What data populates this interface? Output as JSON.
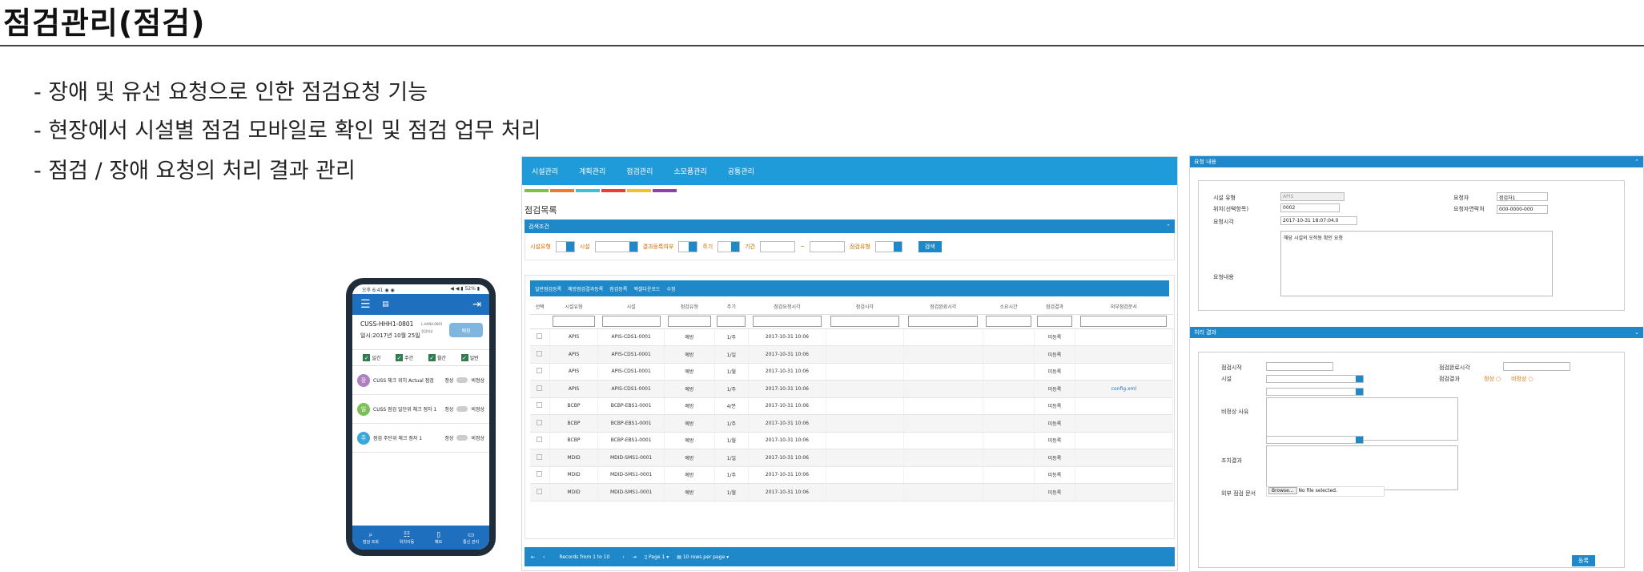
{
  "page": {
    "title": "점검관리(점검)",
    "bullets": [
      "-  장애 및 유선 요청으로 인한 점검요청 기능",
      "-  현장에서 시설별 점검 모바일로 확인 및 점검 업무 처리",
      "-  점검 / 장애 요청의  처리 결과 관리"
    ]
  },
  "phone": {
    "status_left": "오후 6:41 ◉ ◉",
    "status_right": "◀ ◀ ▮ 52% ▮",
    "menu_icon": "hamburger-icon",
    "id": "CUSS-HHH1-0801",
    "date": "일시:2017년 10월 25일",
    "small_label": "L-HANA-0801",
    "small_sub": "점검대상",
    "action_btn": "배정",
    "checks": [
      "일간",
      "주간",
      "월간",
      "일반"
    ],
    "items": [
      {
        "badge": "장",
        "color": "#b07fc0",
        "text": "CUSS 체크 위치 Actual 점검",
        "a": "정상",
        "b": "비정상"
      },
      {
        "badge": "일",
        "color": "#7cbf5a",
        "text": "CUSS 점검 일단위 체크 점자 1",
        "a": "정상",
        "b": "비정상"
      },
      {
        "badge": "주",
        "color": "#3aa7d9",
        "text": "점검 주단위 체크 점자 1",
        "a": "정상",
        "b": "비정상"
      }
    ],
    "nav": [
      "점검 조회",
      "위치이동",
      "메모",
      "통신 관리"
    ]
  },
  "app": {
    "menu": [
      "시설관리",
      "계획관리",
      "점검관리",
      "소모품관리",
      "공통관리"
    ],
    "color_strip": [
      "#7dc243",
      "#f07a2b",
      "#3fbfd8",
      "#e8402f",
      "#f4c030",
      "#8e3fb0"
    ],
    "section_title": "점검목록",
    "search_panel": "검색조건",
    "search_labels": [
      "시설유형",
      "시설",
      "결과등록여부",
      "주기",
      "기간",
      "~",
      "점검유형"
    ],
    "search_btn": "검색",
    "list_tabs": [
      "일반점검등록",
      "예방점검결과등록",
      "점검등록",
      "엑셀다운로드",
      "수정"
    ],
    "columns": [
      "선택",
      "시설유형",
      "시설",
      "점검유형",
      "주기",
      "점검요청시각",
      "점검시각",
      "점검완료시각",
      "소요시간",
      "점검결과",
      "외부점검문서"
    ],
    "rows": [
      [
        "APIS",
        "APIS-CDS1-0001",
        "예방",
        "1/주",
        "2017-10-31 10:06",
        "",
        "",
        "",
        "미등록",
        ""
      ],
      [
        "APIS",
        "APIS-CDS1-0001",
        "예방",
        "1/일",
        "2017-10-31 10:06",
        "",
        "",
        "",
        "미등록",
        ""
      ],
      [
        "APIS",
        "APIS-CDS1-0001",
        "예방",
        "1/월",
        "2017-10-31 10:06",
        "",
        "",
        "",
        "미등록",
        ""
      ],
      [
        "APIS",
        "APIS-CDS1-0001",
        "예방",
        "1/주",
        "2017-10-31 10:06",
        "",
        "",
        "",
        "미등록",
        "config.xml"
      ],
      [
        "BCBP",
        "BCBP-EBS1-0001",
        "예방",
        "4/분",
        "2017-10-31 10:06",
        "",
        "",
        "",
        "미등록",
        ""
      ],
      [
        "BCBP",
        "BCBP-EBS1-0001",
        "예방",
        "1/주",
        "2017-10-31 10:06",
        "",
        "",
        "",
        "미등록",
        ""
      ],
      [
        "BCBP",
        "BCBP-EBS1-0001",
        "예방",
        "1/월",
        "2017-10-31 10:06",
        "",
        "",
        "",
        "미등록",
        ""
      ],
      [
        "MDID",
        "MDID-SMS1-0001",
        "예방",
        "1/일",
        "2017-10-31 10:06",
        "",
        "",
        "",
        "미등록",
        ""
      ],
      [
        "MDID",
        "MDID-SMS1-0001",
        "예방",
        "1/주",
        "2017-10-31 10:06",
        "",
        "",
        "",
        "미등록",
        ""
      ],
      [
        "MDID",
        "MDID-SMS1-0001",
        "예방",
        "1/월",
        "2017-10-31 10:06",
        "",
        "",
        "",
        "미등록",
        ""
      ]
    ],
    "pager_text": "Records from 1 to 10",
    "page_label": "Page 1",
    "rows_per_page": "10 rows per page"
  },
  "request": {
    "head": "요청 내용",
    "facility_type_label": "시설 유형",
    "facility_type_value": "APIS",
    "location_label": "위치(선택항목)",
    "location_value": "0002",
    "requester_label": "요청자",
    "requester_value": "점검자1",
    "contact_label": "요청자연락처",
    "contact_value": "000-0000-000",
    "time_label": "요청시각",
    "time_value": "2017-10-31 18:07:04.0",
    "content_label": "요청내용",
    "content_value": "해당 시설의 오작동 확인 요청"
  },
  "result": {
    "head": "처리 결과",
    "start_label": "점검시작",
    "end_label": "점검완료시각",
    "facility_label": "시설",
    "result_label": "점검결과",
    "normal": "정상",
    "abnormal": "비정상",
    "reason_label": "비정상 사유",
    "action_label": "조치결과",
    "doc_label": "외부 점검 문서",
    "browse": "Browse...",
    "no_file": "No file selected.",
    "save": "등록"
  }
}
